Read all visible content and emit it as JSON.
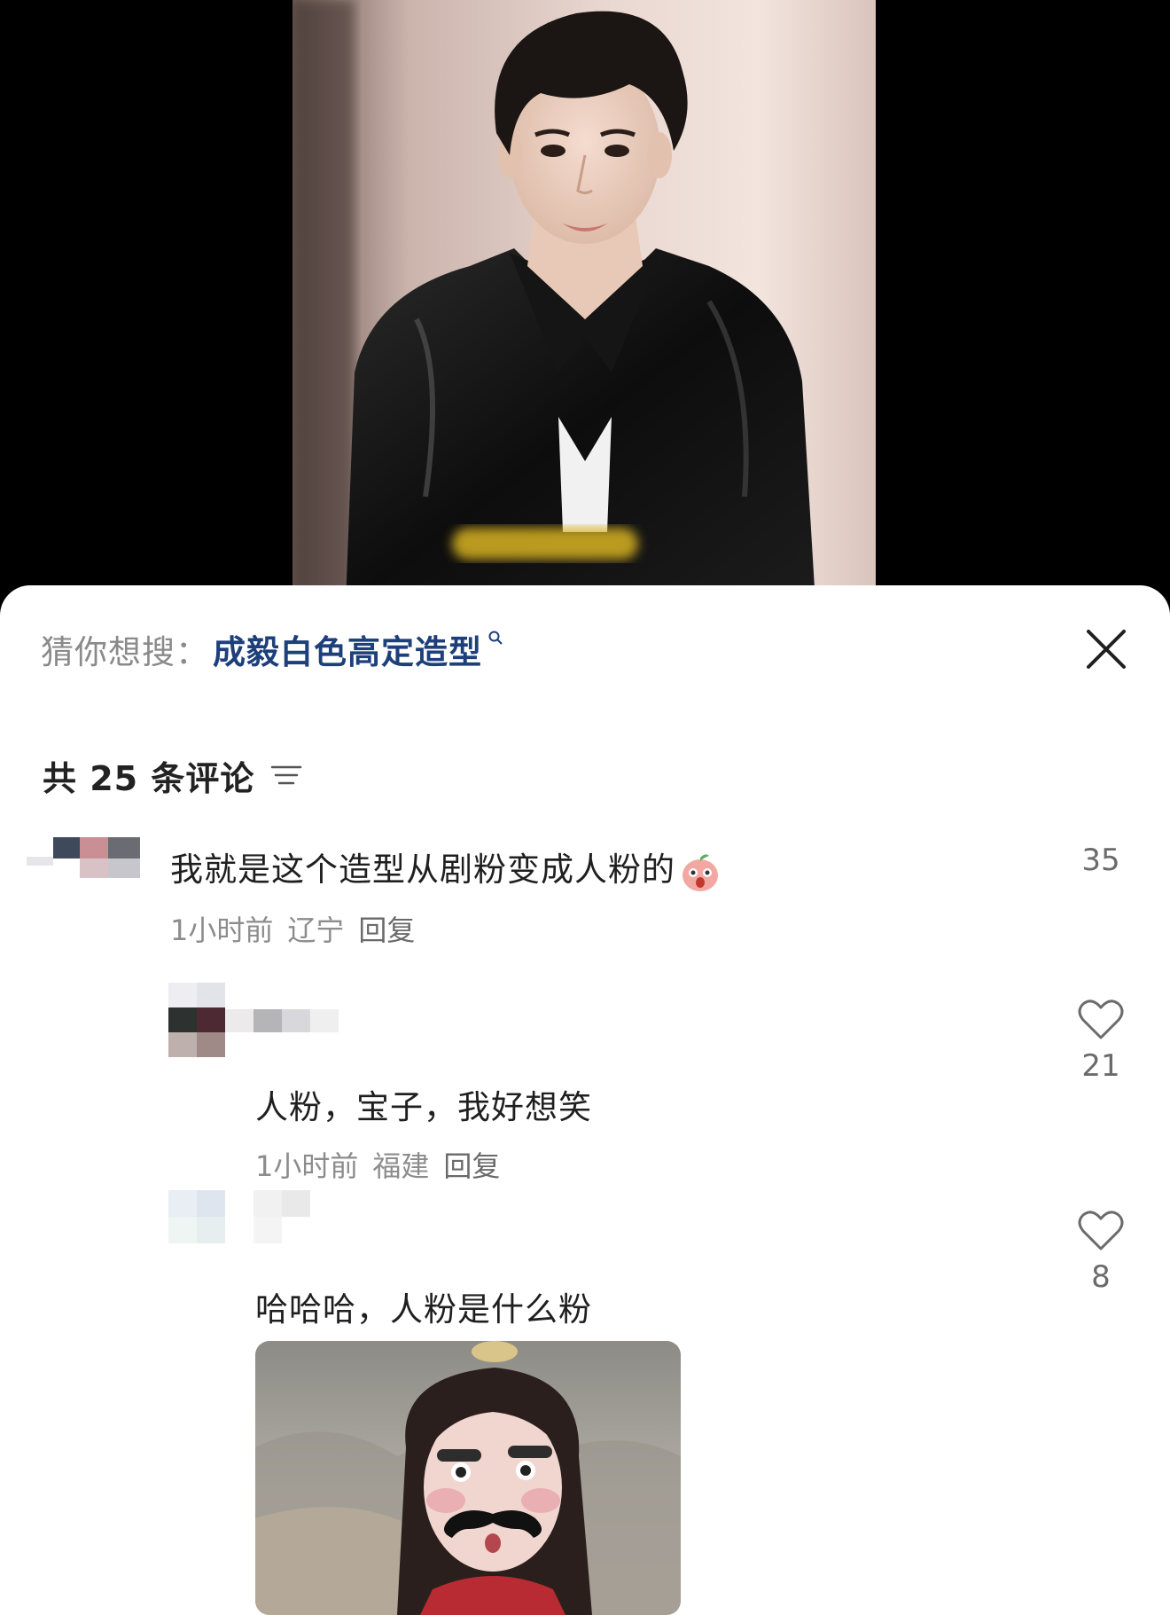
{
  "video": {
    "description_icon": "video-frame",
    "subtitle_blurred": true
  },
  "suggest": {
    "label": "猜你想搜：",
    "query": "成毅白色高定造型"
  },
  "comments_header": {
    "count_text": "共 25 条评论"
  },
  "comments": [
    {
      "text": "我就是这个造型从剧粉变成人粉的",
      "time": "1小时前",
      "location": "辽宁",
      "reply": "回复",
      "likes": "35"
    },
    {
      "text": "人粉，宝子，我好想笑",
      "time": "1小时前",
      "location": "福建",
      "reply": "回复",
      "likes": "21"
    },
    {
      "text": "哈哈哈，人粉是什么粉",
      "likes": "8"
    }
  ],
  "colors": {
    "link": "#1d3f7a",
    "text": "#1f1f1f",
    "meta": "#8c8c8c",
    "background": "#ffffff"
  }
}
